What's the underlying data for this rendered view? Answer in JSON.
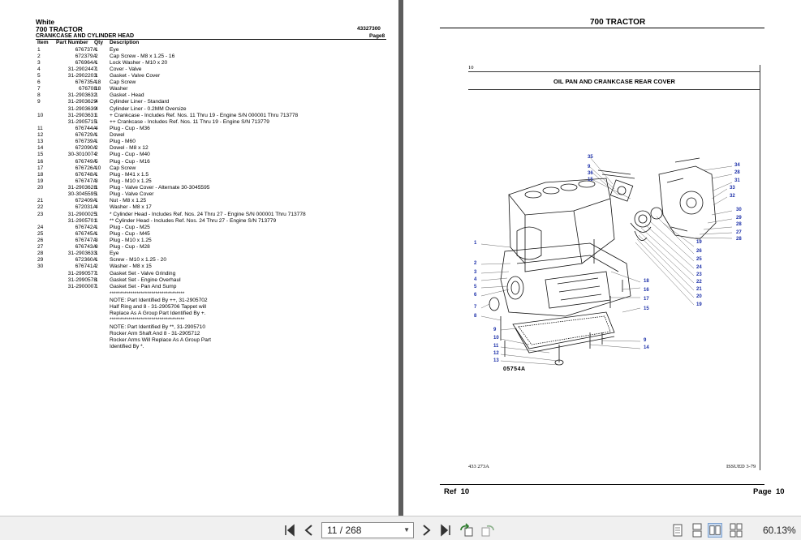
{
  "left_page": {
    "brand": "White",
    "model": "700 TRACTOR",
    "catalog_no": "43327300",
    "section": "CRANKCASE AND CYLINDER HEAD",
    "page_label": "Page8",
    "columns": {
      "item": "Item",
      "part": "Part Number",
      "qty": "Qty",
      "desc": "Description"
    },
    "rows": [
      {
        "item": "1",
        "part": "676737A",
        "qty": "1",
        "desc": "Eye"
      },
      {
        "item": "2",
        "part": "672379A",
        "qty": "2",
        "desc": "Cap Screw - M8 x 1.25 - 16"
      },
      {
        "item": "3",
        "part": "676964A",
        "qty": "1",
        "desc": "Lock Washer - M10 x 20"
      },
      {
        "item": "4",
        "part": "31-2902447",
        "qty": "1",
        "desc": "Cover - Valve"
      },
      {
        "item": "5",
        "part": "31-2902203",
        "qty": "1",
        "desc": "Gasket - Valve Cover"
      },
      {
        "item": "6",
        "part": "676735A",
        "qty": "18",
        "desc": "Cap Screw"
      },
      {
        "item": "7",
        "part": "676708",
        "qty": "18",
        "desc": "Washer"
      },
      {
        "item": "8",
        "part": "31-2903632",
        "qty": "1",
        "desc": "Gasket - Head"
      },
      {
        "item": "9",
        "part": "31-2903629",
        "qty": "4",
        "desc": "Cylinder Liner - Standard"
      },
      {
        "item": "",
        "part": "31-2903630",
        "qty": "4",
        "desc": "Cylinder Liner - 0.2MM Oversize"
      },
      {
        "item": "10",
        "part": "31-2903631",
        "qty": "1",
        "desc": "+ Crankcase - Includes Ref. Nos. 11 Thru 19 - Engine S/N 000001 Thru 713778"
      },
      {
        "item": "",
        "part": "31-2905715",
        "qty": "1",
        "desc": "++ Crankcase - Includes Ref. Nos. 11 Thru 19 - Engine S/N 713779"
      },
      {
        "item": "11",
        "part": "676744A",
        "qty": "4",
        "desc": "Plug - Cup - M36"
      },
      {
        "item": "12",
        "part": "676729A",
        "qty": "1",
        "desc": "Dowel"
      },
      {
        "item": "13",
        "part": "676739A",
        "qty": "1",
        "desc": "Plug - M60"
      },
      {
        "item": "14",
        "part": "672090A",
        "qty": "2",
        "desc": "Dowel - M8 x 12"
      },
      {
        "item": "15",
        "part": "30-3010074",
        "qty": "2",
        "desc": "Plug - Cup - M40"
      },
      {
        "item": "16",
        "part": "676749A",
        "qty": "5",
        "desc": "Plug - Cup - M16"
      },
      {
        "item": "17",
        "part": "676726A",
        "qty": "10",
        "desc": "Cap Screw"
      },
      {
        "item": "18",
        "part": "676748A",
        "qty": "1",
        "desc": "Plug - M41 x 1.5"
      },
      {
        "item": "19",
        "part": "676747A",
        "qty": "3",
        "desc": "Plug - M10 x 1.25"
      },
      {
        "item": "20",
        "part": "31-2903628",
        "qty": "1",
        "desc": "Plug - Valve Cover - Alternate 30-3045595"
      },
      {
        "item": "",
        "part": "30-3045595",
        "qty": "1",
        "desc": "Plug - Valve Cover"
      },
      {
        "item": "21",
        "part": "672409A",
        "qty": "1",
        "desc": "Nut - M8 x 1.25"
      },
      {
        "item": "22",
        "part": "672031A",
        "qty": "4",
        "desc": "Washer - M8 x 17"
      },
      {
        "item": "23",
        "part": "31-2900025",
        "qty": "1",
        "desc": "* Cylinder Head - Includes Ref. Nos. 24 Thru 27 - Engine S/N 000001 Thru 713778"
      },
      {
        "item": "",
        "part": "31-2905701",
        "qty": "1",
        "desc": "** Cylinder Head - Includes Ref. Nos. 24 Thru 27 - Engine S/N 713779"
      },
      {
        "item": "24",
        "part": "676742A",
        "qty": "1",
        "desc": "Plug - Cup - M25"
      },
      {
        "item": "25",
        "part": "676745A",
        "qty": "1",
        "desc": "Plug - Cup - M45"
      },
      {
        "item": "26",
        "part": "676747A",
        "qty": "3",
        "desc": "Plug - M10 x 1.25"
      },
      {
        "item": "27",
        "part": "676743A",
        "qty": "8",
        "desc": "Plug - Cup - M28"
      },
      {
        "item": "28",
        "part": "31-2903633",
        "qty": "1",
        "desc": "Eye"
      },
      {
        "item": "29",
        "part": "672360A",
        "qty": "1",
        "desc": "Screw - M10 x 1.25 - 20"
      },
      {
        "item": "30",
        "part": "676741A",
        "qty": "2",
        "desc": "Washer - M8 x 15"
      },
      {
        "item": "",
        "part": "31-2990577",
        "qty": "1",
        "desc": "Gasket Set - Valve Grinding"
      },
      {
        "item": "",
        "part": "31-2990578",
        "qty": "1",
        "desc": "Gasket Set - Engine Overhaul"
      },
      {
        "item": "",
        "part": "31-2900007",
        "qty": "1",
        "desc": "Gasket Set - Pan And Sump"
      }
    ],
    "notes": [
      "************************************",
      "NOTE: Part Identified By ++, 31-2905702",
      "Half Ring and 8 - 31-2905706 Tappet will",
      "Replace As A Group Part Identified By +.",
      "************************************",
      "NOTE: Part Identified By **, 31-2905710",
      "Rocker Arm Shaft And 8 - 31-2905712",
      "Rocker Arms Will Replace As A Group Part",
      "Identified By *."
    ]
  },
  "right_page": {
    "model": "700 TRACTOR",
    "ref_small": "10",
    "diagram_title": "OIL PAN AND CRANKCASE REAR COVER",
    "figure_code": "05754A",
    "doc_code": "433 273A",
    "issued": "ISSUED 3-79",
    "footer_ref": "Ref  10",
    "footer_page": "Page  10",
    "callouts": [
      "35",
      "9",
      "36",
      "15",
      "34",
      "28",
      "31",
      "33",
      "32",
      "30",
      "29",
      "28",
      "27",
      "28",
      "19",
      "26",
      "25",
      "24",
      "23",
      "22",
      "21",
      "20",
      "19",
      "1",
      "2",
      "3",
      "4",
      "5",
      "6",
      "7",
      "8",
      "9",
      "10",
      "11",
      "12",
      "13",
      "18",
      "16",
      "17",
      "15",
      "9",
      "14"
    ]
  },
  "toolbar": {
    "page_indicator": "11 / 268",
    "zoom": "60.13%"
  }
}
